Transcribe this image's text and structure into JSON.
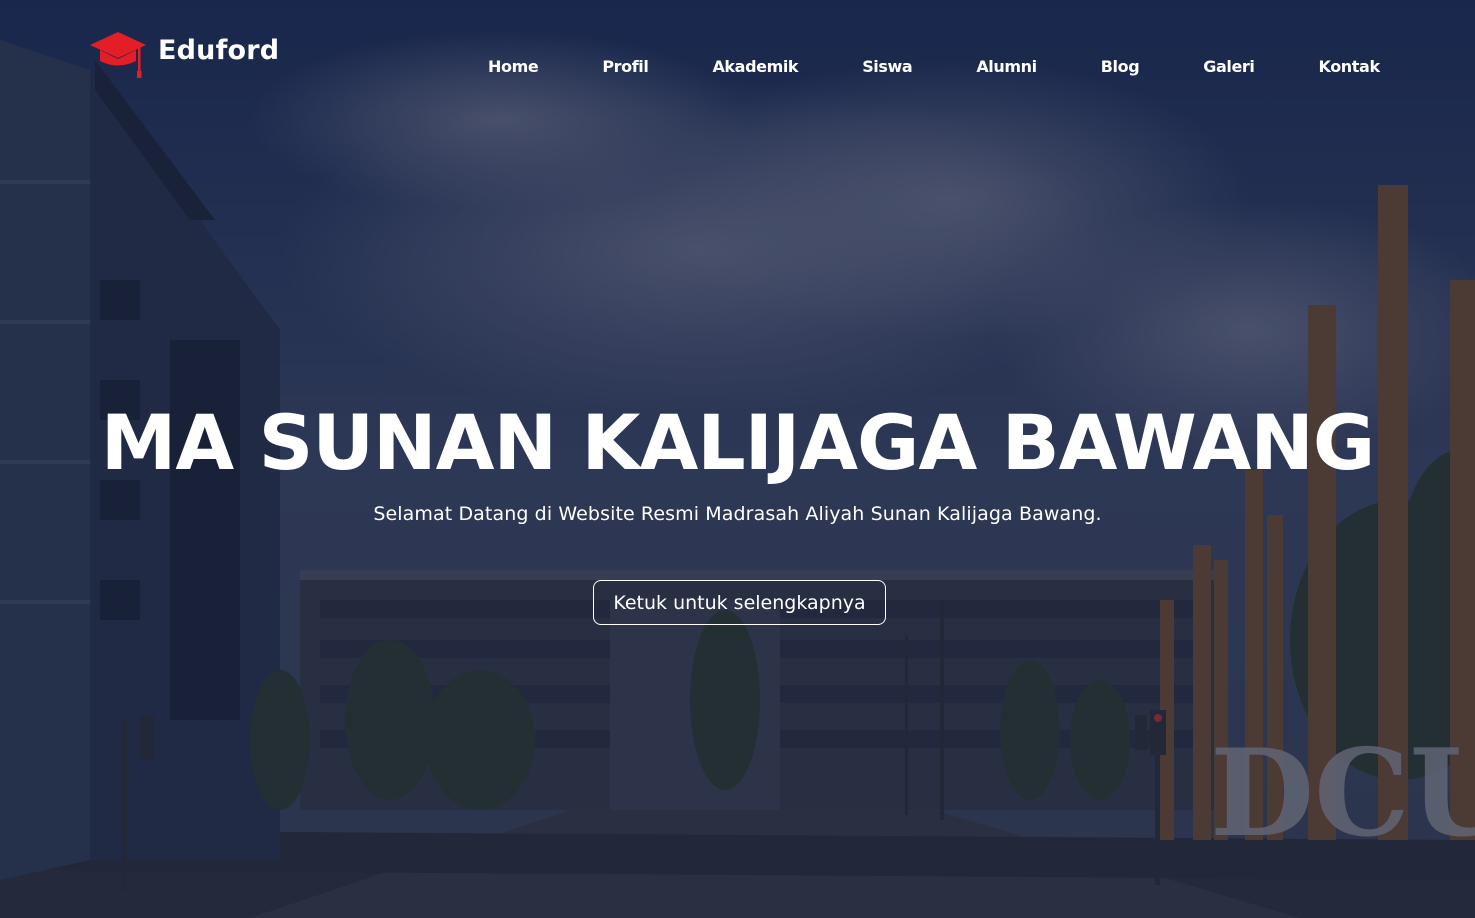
{
  "brand": {
    "name": "Eduford",
    "icon": "graduation-cap-icon",
    "icon_color": "#e41e26"
  },
  "nav": {
    "items": [
      {
        "label": "Home"
      },
      {
        "label": "Profil"
      },
      {
        "label": "Akademik"
      },
      {
        "label": "Siswa"
      },
      {
        "label": "Alumni"
      },
      {
        "label": "Blog"
      },
      {
        "label": "Galeri"
      },
      {
        "label": "Kontak"
      }
    ]
  },
  "hero": {
    "title": "MA SUNAN KALIJAGA BAWANG",
    "subtitle": "Selamat Datang di Website Resmi Madrasah Aliyah Sunan Kalijaga Bawang.",
    "cta_label": "Ketuk untuk selengkapnya",
    "background_sign": "DCU"
  },
  "colors": {
    "overlay": "#141e3c",
    "text": "#ffffff",
    "accent": "#e41e26"
  }
}
